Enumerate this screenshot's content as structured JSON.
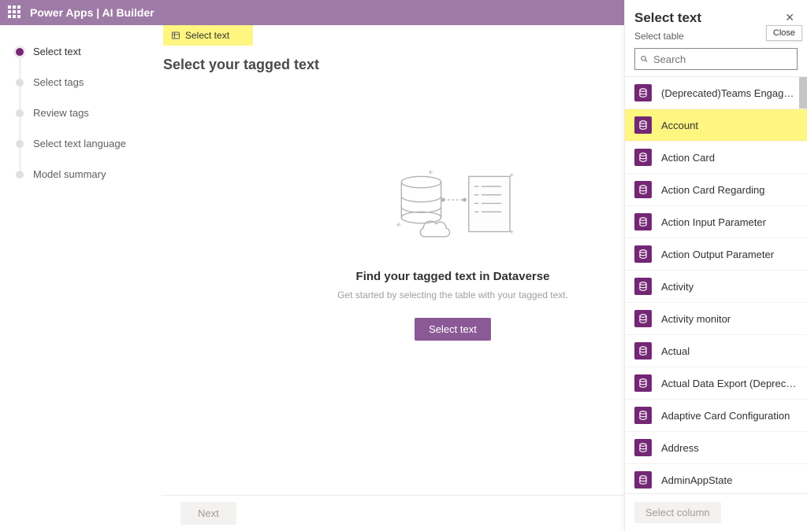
{
  "appbar": {
    "title": "Power Apps  |  AI Builder"
  },
  "steps": [
    {
      "label": "Select text",
      "active": true
    },
    {
      "label": "Select tags",
      "active": false
    },
    {
      "label": "Review tags",
      "active": false
    },
    {
      "label": "Select text language",
      "active": false
    },
    {
      "label": "Model summary",
      "active": false
    }
  ],
  "crumb": {
    "label": "Select text"
  },
  "page": {
    "title": "Select your tagged text"
  },
  "empty": {
    "heading": "Find your tagged text in Dataverse",
    "sub": "Get started by selecting the table with your tagged text.",
    "button": "Select text"
  },
  "footer": {
    "next": "Next"
  },
  "panel": {
    "title": "Select text",
    "subtitle": "Select table",
    "close_tooltip": "Close",
    "search_placeholder": "Search",
    "select_column": "Select column",
    "tables": [
      {
        "label": "(Deprecated)Teams Engagement Co...",
        "highlight": false
      },
      {
        "label": "Account",
        "highlight": true
      },
      {
        "label": "Action Card",
        "highlight": false
      },
      {
        "label": "Action Card Regarding",
        "highlight": false
      },
      {
        "label": "Action Input Parameter",
        "highlight": false
      },
      {
        "label": "Action Output Parameter",
        "highlight": false
      },
      {
        "label": "Activity",
        "highlight": false
      },
      {
        "label": "Activity monitor",
        "highlight": false
      },
      {
        "label": "Actual",
        "highlight": false
      },
      {
        "label": "Actual Data Export (Deprecated)",
        "highlight": false
      },
      {
        "label": "Adaptive Card Configuration",
        "highlight": false
      },
      {
        "label": "Address",
        "highlight": false
      },
      {
        "label": "AdminAppState",
        "highlight": false
      }
    ]
  },
  "colors": {
    "brand": "#742774",
    "highlight": "#fff581"
  }
}
